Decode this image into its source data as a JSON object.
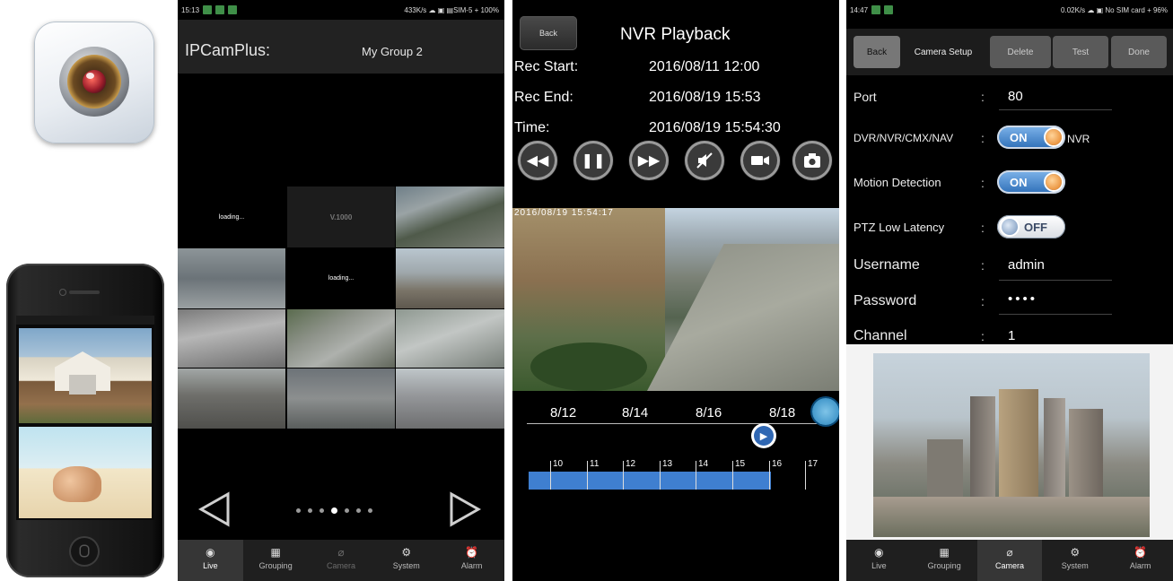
{
  "phone1": {
    "status": {
      "time": "15:13",
      "right": "433K/s ☁ ▣ ▤SIM-5 + 100%"
    },
    "app_title": "IPCamPlus:",
    "group_name": "My Group 2",
    "loading_text": "loading...",
    "stream_label": "V.1000",
    "tabs": [
      {
        "label": "Live",
        "icon": "live-icon"
      },
      {
        "label": "Grouping",
        "icon": "grouping-icon"
      },
      {
        "label": "Camera",
        "icon": "camera-icon"
      },
      {
        "label": "System",
        "icon": "gear-icon"
      },
      {
        "label": "Alarm",
        "icon": "alarm-icon"
      }
    ],
    "pages": {
      "count": 7,
      "current": 4
    }
  },
  "phone2": {
    "back_label": "Back",
    "title": "NVR Playback",
    "rec_start_label": "Rec Start:",
    "rec_start_value": "2016/08/11 12:00",
    "rec_end_label": "Rec End:",
    "rec_end_value": "2016/08/19 15:53",
    "time_label": "Time:",
    "time_value": "2016/08/19 15:54:30",
    "osd_text": "2016/08/19 15:54:17",
    "dates": [
      "8/12",
      "8/14",
      "8/16",
      "8/18"
    ],
    "hours": [
      "10",
      "11",
      "12",
      "13",
      "14",
      "15",
      "16",
      "17"
    ]
  },
  "phone3": {
    "status": {
      "time": "14:47",
      "right": "0.02K/s ☁ ▣ No SIM card + 96%"
    },
    "buttons": {
      "back": "Back",
      "title": "Camera Setup",
      "delete": "Delete",
      "test": "Test",
      "done": "Done"
    },
    "fields": {
      "port_label": "Port",
      "port_value": "80",
      "dvr_label": "DVR/NVR/CMX/NAV",
      "dvr_toggle": "ON",
      "dvr_suffix": "NVR",
      "motion_label": "Motion Detection",
      "motion_toggle": "ON",
      "ptz_label": "PTZ Low Latency",
      "ptz_toggle": "OFF",
      "user_label": "Username",
      "user_value": "admin",
      "pass_label": "Password",
      "pass_value": "••••",
      "channel_label": "Channel",
      "channel_value": "1"
    },
    "colon": ":",
    "tabs": [
      {
        "label": "Live",
        "icon": "live-icon"
      },
      {
        "label": "Grouping",
        "icon": "grouping-icon"
      },
      {
        "label": "Camera",
        "icon": "camera-icon"
      },
      {
        "label": "System",
        "icon": "gear-icon"
      },
      {
        "label": "Alarm",
        "icon": "alarm-icon"
      }
    ]
  }
}
